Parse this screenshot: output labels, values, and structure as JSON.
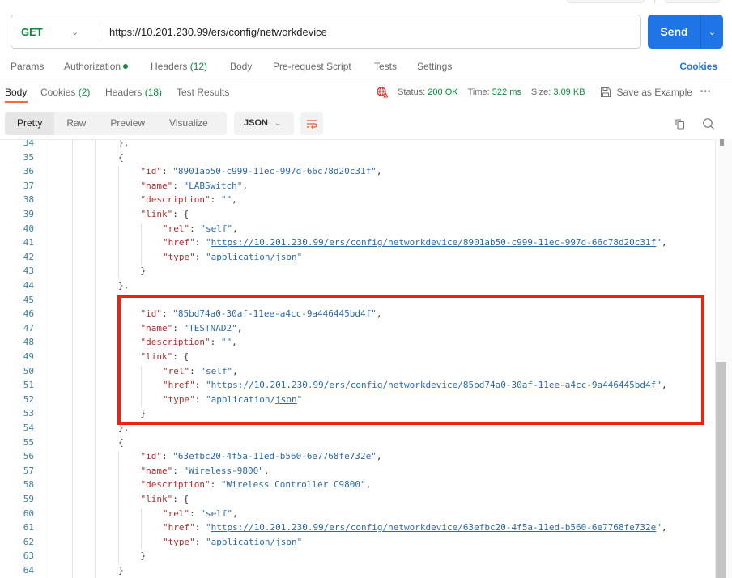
{
  "request": {
    "method": "GET",
    "url": "https://10.201.230.99/ers/config/networkdevice",
    "send_label": "Send"
  },
  "request_tabs": {
    "params": "Params",
    "authorization": "Authorization",
    "headers": "Headers",
    "headers_count": "(12)",
    "body": "Body",
    "pre_request": "Pre-request Script",
    "tests": "Tests",
    "settings": "Settings",
    "cookies": "Cookies"
  },
  "response_tabs": {
    "body": "Body",
    "cookies": "Cookies",
    "cookies_count": "(2)",
    "headers": "Headers",
    "headers_count": "(18)",
    "test_results": "Test Results"
  },
  "status": {
    "status_label": "Status:",
    "status_value": "200 OK",
    "time_label": "Time:",
    "time_value": "522 ms",
    "size_label": "Size:",
    "size_value": "3.09 KB",
    "save_example": "Save as Example",
    "more": "•••"
  },
  "body_toolbar": {
    "views": [
      "Pretty",
      "Raw",
      "Preview",
      "Visualize"
    ],
    "active_view": "Pretty",
    "format": "JSON"
  },
  "colors": {
    "accent_blue": "#1f74e6",
    "success_green": "#0c8a3d",
    "active_tab_underline": "#f26b3a",
    "highlight_box": "#f11f0c"
  },
  "code_lines": [
    {
      "n": "34",
      "indent": 0,
      "parts": [
        [
          "p",
          "},"
        ]
      ]
    },
    {
      "n": "35",
      "indent": 0,
      "parts": [
        [
          "p",
          "{"
        ]
      ]
    },
    {
      "n": "36",
      "indent": 1,
      "parts": [
        [
          "k",
          "\"id\""
        ],
        [
          "p",
          ": "
        ],
        [
          "s",
          "\"8901ab50-c999-11ec-997d-66c78d20c31f\""
        ],
        [
          "p",
          ","
        ]
      ]
    },
    {
      "n": "37",
      "indent": 1,
      "parts": [
        [
          "k",
          "\"name\""
        ],
        [
          "p",
          ": "
        ],
        [
          "s",
          "\"LABSwitch\""
        ],
        [
          "p",
          ","
        ]
      ]
    },
    {
      "n": "38",
      "indent": 1,
      "parts": [
        [
          "k",
          "\"description\""
        ],
        [
          "p",
          ": "
        ],
        [
          "s",
          "\"\""
        ],
        [
          "p",
          ","
        ]
      ]
    },
    {
      "n": "39",
      "indent": 1,
      "parts": [
        [
          "k",
          "\"link\""
        ],
        [
          "p",
          ": {"
        ]
      ]
    },
    {
      "n": "40",
      "indent": 2,
      "parts": [
        [
          "k",
          "\"rel\""
        ],
        [
          "p",
          ": "
        ],
        [
          "s",
          "\"self\""
        ],
        [
          "p",
          ","
        ]
      ]
    },
    {
      "n": "41",
      "indent": 2,
      "parts": [
        [
          "k",
          "\"href\""
        ],
        [
          "p",
          ": "
        ],
        [
          "s",
          "\""
        ],
        [
          "u",
          "https://10.201.230.99/ers/config/networkdevice/8901ab50-c999-11ec-997d-66c78d20c31f"
        ],
        [
          "s",
          "\""
        ],
        [
          "p",
          ","
        ]
      ]
    },
    {
      "n": "42",
      "indent": 2,
      "parts": [
        [
          "k",
          "\"type\""
        ],
        [
          "p",
          ": "
        ],
        [
          "s",
          "\"application/"
        ],
        [
          "u",
          "json"
        ],
        [
          "s",
          "\""
        ]
      ]
    },
    {
      "n": "43",
      "indent": 1,
      "parts": [
        [
          "p",
          "}"
        ]
      ]
    },
    {
      "n": "44",
      "indent": 0,
      "parts": [
        [
          "p",
          "},"
        ]
      ]
    },
    {
      "n": "45",
      "indent": 0,
      "parts": [
        [
          "p",
          "{"
        ]
      ]
    },
    {
      "n": "46",
      "indent": 1,
      "parts": [
        [
          "k",
          "\"id\""
        ],
        [
          "p",
          ": "
        ],
        [
          "s",
          "\"85bd74a0-30af-11ee-a4cc-9a446445bd4f\""
        ],
        [
          "p",
          ","
        ]
      ]
    },
    {
      "n": "47",
      "indent": 1,
      "parts": [
        [
          "k",
          "\"name\""
        ],
        [
          "p",
          ": "
        ],
        [
          "s",
          "\"TESTNAD2\""
        ],
        [
          "p",
          ","
        ]
      ]
    },
    {
      "n": "48",
      "indent": 1,
      "parts": [
        [
          "k",
          "\"description\""
        ],
        [
          "p",
          ": "
        ],
        [
          "s",
          "\"\""
        ],
        [
          "p",
          ","
        ]
      ]
    },
    {
      "n": "49",
      "indent": 1,
      "parts": [
        [
          "k",
          "\"link\""
        ],
        [
          "p",
          ": {"
        ]
      ]
    },
    {
      "n": "50",
      "indent": 2,
      "parts": [
        [
          "k",
          "\"rel\""
        ],
        [
          "p",
          ": "
        ],
        [
          "s",
          "\"self\""
        ],
        [
          "p",
          ","
        ]
      ]
    },
    {
      "n": "51",
      "indent": 2,
      "parts": [
        [
          "k",
          "\"href\""
        ],
        [
          "p",
          ": "
        ],
        [
          "s",
          "\""
        ],
        [
          "u",
          "https://10.201.230.99/ers/config/networkdevice/85bd74a0-30af-11ee-a4cc-9a446445bd4f"
        ],
        [
          "s",
          "\""
        ],
        [
          "p",
          ","
        ]
      ]
    },
    {
      "n": "52",
      "indent": 2,
      "parts": [
        [
          "k",
          "\"type\""
        ],
        [
          "p",
          ": "
        ],
        [
          "s",
          "\"application/"
        ],
        [
          "u",
          "json"
        ],
        [
          "s",
          "\""
        ]
      ]
    },
    {
      "n": "53",
      "indent": 1,
      "parts": [
        [
          "p",
          "}"
        ]
      ]
    },
    {
      "n": "54",
      "indent": 0,
      "parts": [
        [
          "p",
          "},"
        ]
      ]
    },
    {
      "n": "55",
      "indent": 0,
      "parts": [
        [
          "p",
          "{"
        ]
      ]
    },
    {
      "n": "56",
      "indent": 1,
      "parts": [
        [
          "k",
          "\"id\""
        ],
        [
          "p",
          ": "
        ],
        [
          "s",
          "\"63efbc20-4f5a-11ed-b560-6e7768fe732e\""
        ],
        [
          "p",
          ","
        ]
      ]
    },
    {
      "n": "57",
      "indent": 1,
      "parts": [
        [
          "k",
          "\"name\""
        ],
        [
          "p",
          ": "
        ],
        [
          "s",
          "\"Wireless-9800\""
        ],
        [
          "p",
          ","
        ]
      ]
    },
    {
      "n": "58",
      "indent": 1,
      "parts": [
        [
          "k",
          "\"description\""
        ],
        [
          "p",
          ": "
        ],
        [
          "s",
          "\"Wireless Controller C9800\""
        ],
        [
          "p",
          ","
        ]
      ]
    },
    {
      "n": "59",
      "indent": 1,
      "parts": [
        [
          "k",
          "\"link\""
        ],
        [
          "p",
          ": {"
        ]
      ]
    },
    {
      "n": "60",
      "indent": 2,
      "parts": [
        [
          "k",
          "\"rel\""
        ],
        [
          "p",
          ": "
        ],
        [
          "s",
          "\"self\""
        ],
        [
          "p",
          ","
        ]
      ]
    },
    {
      "n": "61",
      "indent": 2,
      "parts": [
        [
          "k",
          "\"href\""
        ],
        [
          "p",
          ": "
        ],
        [
          "s",
          "\""
        ],
        [
          "u",
          "https://10.201.230.99/ers/config/networkdevice/63efbc20-4f5a-11ed-b560-6e7768fe732e"
        ],
        [
          "s",
          "\""
        ],
        [
          "p",
          ","
        ]
      ]
    },
    {
      "n": "62",
      "indent": 2,
      "parts": [
        [
          "k",
          "\"type\""
        ],
        [
          "p",
          ": "
        ],
        [
          "s",
          "\"application/"
        ],
        [
          "u",
          "json"
        ],
        [
          "s",
          "\""
        ]
      ]
    },
    {
      "n": "63",
      "indent": 1,
      "parts": [
        [
          "p",
          "}"
        ]
      ]
    },
    {
      "n": "64",
      "indent": 0,
      "parts": [
        [
          "p",
          "}"
        ]
      ]
    }
  ],
  "annotation": {
    "highlighted_object_name": "TESTNAD2"
  }
}
